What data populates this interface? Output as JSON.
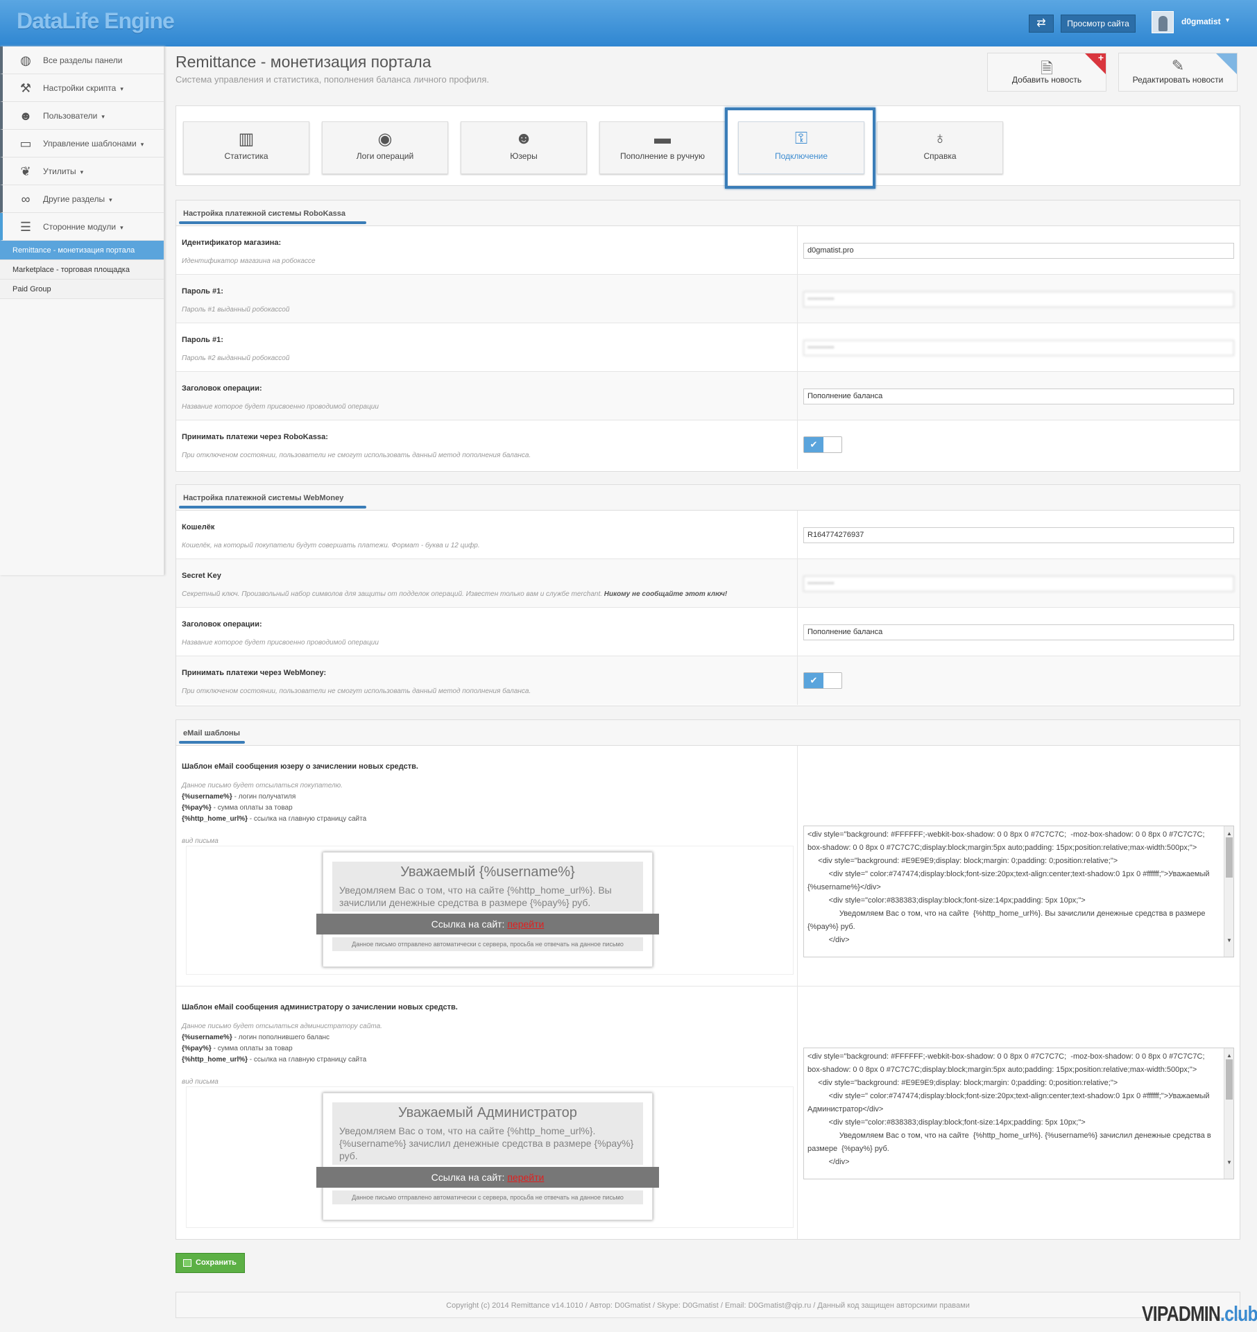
{
  "topbar": {
    "logo": "DataLife Engine",
    "swap_icon": "⇄",
    "view_site": "Просмотр сайта",
    "user": "d0gmatist",
    "caret": "▾"
  },
  "sidebar": {
    "items": [
      {
        "label": "Все разделы панели",
        "icon": "globe-icon",
        "glyph": "◍",
        "caret": ""
      },
      {
        "label": "Настройки скрипта",
        "icon": "wrench-icon",
        "glyph": "⚒",
        "caret": "▾"
      },
      {
        "label": "Пользователи",
        "icon": "user-icon",
        "glyph": "☻",
        "caret": "▾"
      },
      {
        "label": "Управление шаблонами",
        "icon": "laptop-icon",
        "glyph": "▭",
        "caret": "▾"
      },
      {
        "label": "Утилиты",
        "icon": "leaf-icon",
        "glyph": "❦",
        "caret": "▾"
      },
      {
        "label": "Другие разделы",
        "icon": "link-icon",
        "glyph": "∞",
        "caret": "▾"
      },
      {
        "label": "Сторонние модули",
        "icon": "list-icon",
        "glyph": "☰",
        "caret": "▾"
      }
    ],
    "sub_items": [
      "Remittance - монетизация портала",
      "Marketplace - торговая площадка",
      "Paid Group"
    ]
  },
  "header": {
    "title": "Remittance - монетизация портала",
    "subtitle": "Система управления и статистика, пополнения баланса личного профиля."
  },
  "quick": {
    "add_news": "Добавить новость",
    "edit_news": "Редактировать новости",
    "plus": "+"
  },
  "tabs": [
    {
      "label": "Статистика",
      "icon": "bar-chart-icon",
      "glyph": "▥"
    },
    {
      "label": "Логи операций",
      "icon": "eye-icon",
      "glyph": "◉"
    },
    {
      "label": "Юзеры",
      "icon": "users-icon",
      "glyph": "☻"
    },
    {
      "label": "Пополнение в ручную",
      "icon": "credit-card-icon",
      "glyph": "▬"
    },
    {
      "label": "Подключение",
      "icon": "key-icon",
      "glyph": "⚿"
    },
    {
      "label": "Справка",
      "icon": "lightbulb-icon",
      "glyph": "♁"
    }
  ],
  "robokassa": {
    "title": "Настройка платежной системы RoboKassa",
    "rows": [
      {
        "label": "Идентификатор магазина:",
        "hint": "Идентификатор магазина на робокассе",
        "value": "d0gmatist.pro"
      },
      {
        "label": "Пароль #1:",
        "hint": "Пароль #1 выданный робокассой",
        "value": "••••••••••"
      },
      {
        "label": "Пароль #1:",
        "hint": "Пароль #2 выданный робокассой",
        "value": "••••••••••"
      },
      {
        "label": "Заголовок операции:",
        "hint": "Название которое будет присвоенно проводимой операции",
        "value": "Пополнение баланса"
      },
      {
        "label": "Принимать платежи через RoboKassa:",
        "hint": "При отключеном состоянии, пользователи не смогут использовать данный метод пополнения баланса."
      }
    ]
  },
  "webmoney": {
    "title": "Настройка платежной системы WebMoney",
    "rows": [
      {
        "label": "Кошелёк",
        "hint": "Кошелёк, на который покупатели будут совершать платежи. Формат - буква и 12 цифр.",
        "value": "R164774276937"
      },
      {
        "label": "Secret Key",
        "hint": "Секретный ключ. Произвольный набор символов для защиты от подделок операций. Известен только вам и службе merchant.",
        "hint_bold": "Никому не сообщайте этот ключ!",
        "value": "••••••••••"
      },
      {
        "label": "Заголовок операции:",
        "hint": "Название которое будет присвоенно проводимой операции",
        "value": "Пополнение баланса"
      },
      {
        "label": "Принимать платежи через WebMoney:",
        "hint": "При отключеном состоянии, пользователи не смогут использовать данный метод пополнения баланса."
      }
    ]
  },
  "toggle_check": "✔",
  "email": {
    "title": "eMail шаблоны",
    "user_tpl": {
      "label": "Шаблон eMail сообщения юзеру о зачислении новых средств.",
      "intro": "Данное письмо будет отсылаться покупателю.",
      "vars": [
        {
          "name": "{%username%}",
          "desc": " - логин получатиля"
        },
        {
          "name": "{%pay%}",
          "desc": " - сумма оплаты за товар"
        },
        {
          "name": "{%http_home_url%}",
          "desc": " - ссылка на главную страницу сайта"
        }
      ],
      "preview_label": "вид письма",
      "letter_title": "Уважаемый {%username%}",
      "letter_text": "Уведомляем Вас о том, что на сайте {%http_home_url%}. Вы зачислили денежные средства в размере {%pay%} руб.",
      "link_text": "Ссылка на сайт:",
      "link_anchor": "перейти",
      "foot": "Данное письмо отправлено автоматически с сервера, просьба не отвечать на данное письмо",
      "code": "<div style=\"background: #FFFFFF;-webkit-box-shadow: 0 0 8px 0 #7C7C7C;  -moz-box-shadow: 0 0 8px 0 #7C7C7C;  box-shadow: 0 0 8px 0 #7C7C7C;display:block;margin:5px auto;padding: 15px;position:relative;max-width:500px;\">\n     <div style=\"background: #E9E9E9;display: block;margin: 0;padding: 0;position:relative;\">\n          <div style=\" color:#747474;display:block;font-size:20px;text-align:center;text-shadow:0 1px 0 #ffffff;\">Уважаемый {%username%}</div>\n          <div style=\"color:#838383;display:block;font-size:14px;padding: 5px 10px;\">\n               Уведомляем Вас о том, что на сайте  {%http_home_url%}. Вы зачислили денежные средства в размере  {%pay%} руб.\n          </div>"
    },
    "admin_tpl": {
      "label": "Шаблон eMail сообщения администратору о зачислении новых средств.",
      "intro": "Данное письмо будет отсылаться администратору сайта.",
      "vars": [
        {
          "name": "{%username%}",
          "desc": " - логин пополнившего баланс"
        },
        {
          "name": "{%pay%}",
          "desc": " - сумма оплаты за товар"
        },
        {
          "name": "{%http_home_url%}",
          "desc": " - ссылка на главную страницу сайта"
        }
      ],
      "preview_label": "вид письма",
      "letter_title": "Уважаемый Администратор",
      "letter_text": "Уведомляем Вас о том, что на сайте {%http_home_url%}. {%username%} зачислил денежные средства в размере {%pay%} руб.",
      "link_text": "Ссылка на сайт:",
      "link_anchor": "перейти",
      "foot": "Данное письмо отправлено автоматически с сервера, просьба не отвечать на данное письмо",
      "code": "<div style=\"background: #FFFFFF;-webkit-box-shadow: 0 0 8px 0 #7C7C7C;  -moz-box-shadow: 0 0 8px 0 #7C7C7C;  box-shadow: 0 0 8px 0 #7C7C7C;display:block;margin:5px auto;padding: 15px;position:relative;max-width:500px;\">\n     <div style=\"background: #E9E9E9;display: block;margin: 0;padding: 0;position:relative;\">\n          <div style=\" color:#747474;display:block;font-size:20px;text-align:center;text-shadow:0 1px 0 #ffffff;\">Уважаемый Администратор</div>\n          <div style=\"color:#838383;display:block;font-size:14px;padding: 5px 10px;\">\n               Уведомляем Вас о том, что на сайте  {%http_home_url%}. {%username%} зачислил денежные средства в размере  {%pay%} руб.\n          </div>"
    }
  },
  "save": "Сохранить",
  "footer": "Copyright (c) 2014 Remittance v14.1010 / Автор: D0Gmatist / Skype: D0Gmatist / Email: D0Gmatist@qip.ru / Данный код защищен авторскими правами",
  "watermark": {
    "main": "VIPADMIN",
    "suffix": ".club"
  }
}
